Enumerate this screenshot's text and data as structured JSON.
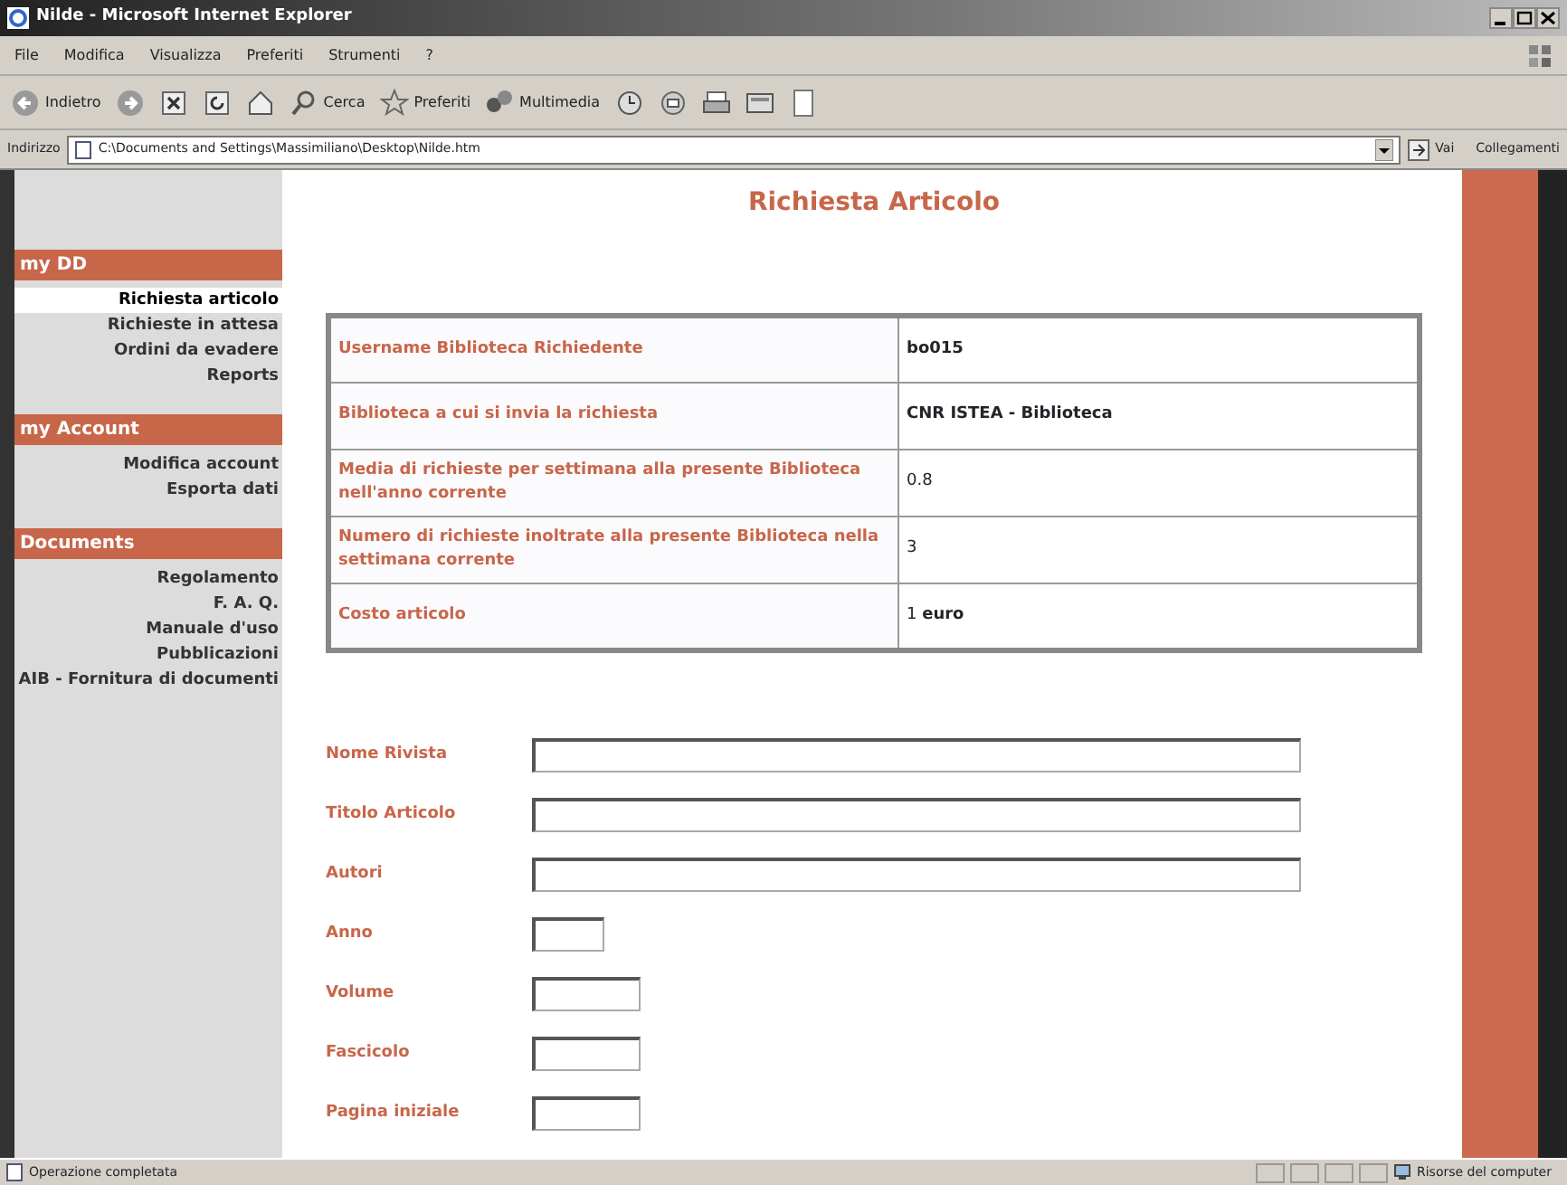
{
  "window": {
    "title": "Nilde - Microsoft Internet Explorer"
  },
  "menu": [
    "File",
    "Modifica",
    "Visualizza",
    "Preferiti",
    "Strumenti",
    "?"
  ],
  "toolbar": [
    {
      "kind": "back",
      "label": "Indietro"
    },
    {
      "kind": "forward"
    },
    {
      "kind": "stop"
    },
    {
      "kind": "refresh"
    },
    {
      "kind": "home"
    },
    {
      "kind": "search",
      "label": "Cerca"
    },
    {
      "kind": "favorites",
      "label": "Preferiti"
    },
    {
      "kind": "media",
      "label": "Multimedia"
    },
    {
      "kind": "history"
    },
    {
      "kind": "mail"
    },
    {
      "kind": "print"
    },
    {
      "kind": "edit"
    },
    {
      "kind": "page"
    }
  ],
  "address": {
    "label": "Indirizzo",
    "value": "C:\\Documents and Settings\\Massimiliano\\Desktop\\Nilde.htm",
    "go": "Vai",
    "links": "Collegamenti"
  },
  "sidebar": {
    "sections": [
      {
        "title": "my DD",
        "items": [
          {
            "label": "Richiesta articolo",
            "selected": true
          },
          {
            "label": "Richieste in attesa",
            "selected": false
          },
          {
            "label": "Ordini da evadere",
            "selected": false
          },
          {
            "label": "Reports",
            "selected": false
          }
        ]
      },
      {
        "title": "my Account",
        "items": [
          {
            "label": "Modifica account",
            "selected": false
          },
          {
            "label": "Esporta dati",
            "selected": false
          }
        ]
      },
      {
        "title": "Documents",
        "items": [
          {
            "label": "Regolamento",
            "selected": false
          },
          {
            "label": "F. A. Q.",
            "selected": false
          },
          {
            "label": "Manuale d'uso",
            "selected": false
          },
          {
            "label": "Pubblicazioni",
            "selected": false
          },
          {
            "label": "AIB - Fornitura di documenti",
            "selected": false
          }
        ]
      }
    ]
  },
  "page_title": "Richiesta Articolo",
  "info_table": {
    "rows": [
      {
        "label": "Username Biblioteca Richiedente",
        "value": "bo015",
        "value_bold": true
      },
      {
        "label": "Biblioteca a cui si invia la richiesta",
        "value": "CNR ISTEA - Biblioteca",
        "value_bold": true
      },
      {
        "label": "Media di richieste per settimana alla presente Biblioteca nell'anno corrente",
        "value": "0.8",
        "value_bold": false
      },
      {
        "label": "Numero di richieste inoltrate alla presente Biblioteca nella settimana corrente",
        "value": "3",
        "value_bold": false
      },
      {
        "label": "Costo articolo",
        "value": "1 **euro**",
        "value_bold": false
      }
    ]
  },
  "form": {
    "fields": [
      {
        "label": "Nome Rivista",
        "kind": "wide"
      },
      {
        "label": "Titolo Articolo",
        "kind": "wide"
      },
      {
        "label": "Autori",
        "kind": "wide"
      },
      {
        "label": "Anno",
        "kind": "tiny"
      },
      {
        "label": "Volume",
        "kind": "small"
      },
      {
        "label": "Fascicolo",
        "kind": "small"
      },
      {
        "label": "Pagina iniziale",
        "kind": "small"
      }
    ]
  },
  "status_bar": {
    "text": "Operazione completata",
    "zone": "Risorse del computer"
  }
}
